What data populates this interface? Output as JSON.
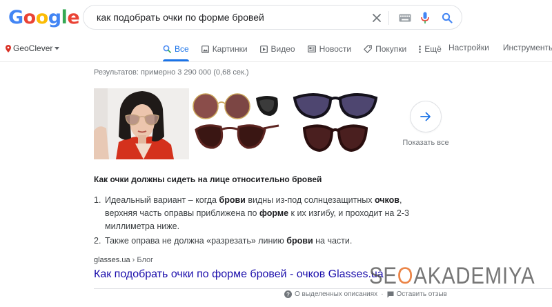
{
  "logo": {
    "letters": [
      "G",
      "o",
      "o",
      "g",
      "l",
      "e"
    ],
    "colors": [
      "#4285F4",
      "#EA4335",
      "#FBBC05",
      "#4285F4",
      "#34A853",
      "#EA4335"
    ]
  },
  "search": {
    "query": "как подобрать очки по форме бровей"
  },
  "location": {
    "label": "GeoClever"
  },
  "tabs": [
    {
      "label": "Все",
      "icon": "search-icon"
    },
    {
      "label": "Картинки",
      "icon": "image-icon"
    },
    {
      "label": "Видео",
      "icon": "video-icon"
    },
    {
      "label": "Новости",
      "icon": "news-icon"
    },
    {
      "label": "Покупки",
      "icon": "tag-icon"
    },
    {
      "label": "Ещё",
      "icon": "more-icon"
    }
  ],
  "tools": {
    "settings": "Настройки",
    "tools": "Инструменты"
  },
  "results_stats": "Результатов: примерно 3 290 000 (0,68 сек.)",
  "images": {
    "show_all": "Показать все"
  },
  "snippet": {
    "heading": "Как очки должны сидеть на лице относительно бровей",
    "items": [
      {
        "num": "1.",
        "t1": "Идеальный вариант – когда ",
        "b1": "брови",
        "t2": " видны из-под солнцезащитных ",
        "b2": "очков",
        "t3": ", верхняя часть оправы приближена по ",
        "b3": "форме",
        "t4": " к их изгибу, и проходит на 2-3 миллиметра ниже."
      },
      {
        "num": "2.",
        "t1": "Также оправа не должна «разрезать» линию ",
        "b1": "брови",
        "t2": " на части."
      }
    ]
  },
  "source": {
    "domain": "glasses.ua",
    "breadcrumb": "› Блог"
  },
  "result": {
    "title": "Как подобрать очки по форме бровей - очков Glasses.ua"
  },
  "watermark": {
    "pre": "SE",
    "o": "O",
    "post": "AKADEMIYA"
  },
  "footer": {
    "about": "О выделенных описаниях",
    "feedback": "Оставить отзыв"
  },
  "colors": {
    "accent": "#1a73e8",
    "link": "#1a0dab",
    "watermark_accent": "#e87028"
  }
}
